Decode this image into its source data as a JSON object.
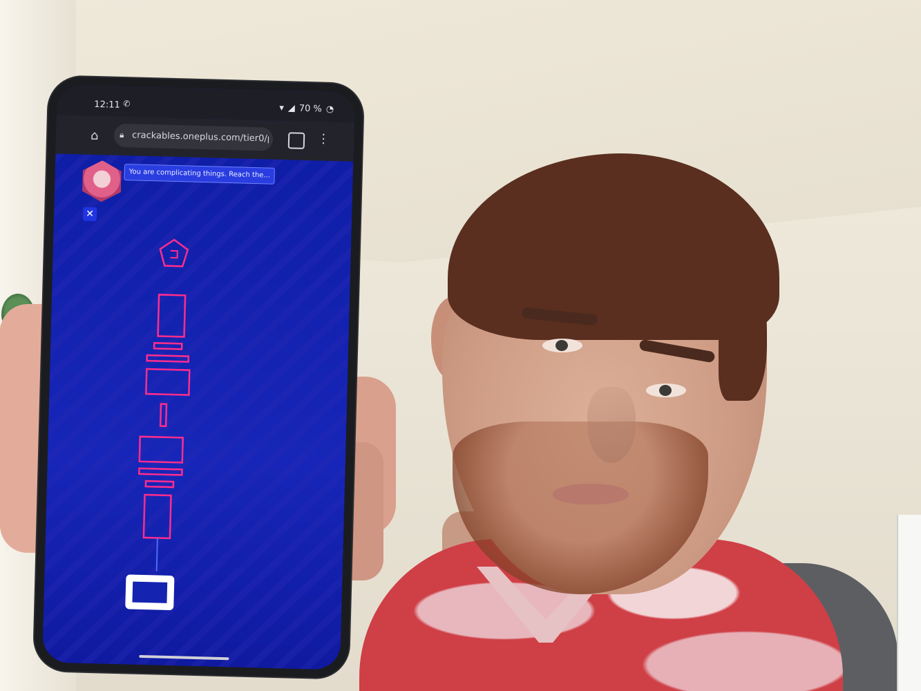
{
  "status_bar": {
    "time": "12:11",
    "battery": "70 %"
  },
  "browser": {
    "url": "crackables.oneplus.com/tier0/p"
  },
  "game": {
    "speech_text": "You are complicating things. Reach the...",
    "colors": {
      "background": "#1424b0",
      "neon": "#ff2d8c",
      "panel": "#2a3de0"
    }
  },
  "icons": {
    "home": "home-icon",
    "lock": "lock-icon",
    "tabs": "tabs-icon",
    "menu": "menu-icon",
    "close": "close-icon",
    "whatsapp": "whatsapp-icon",
    "wifi": "wifi-icon",
    "battery": "battery-icon"
  }
}
